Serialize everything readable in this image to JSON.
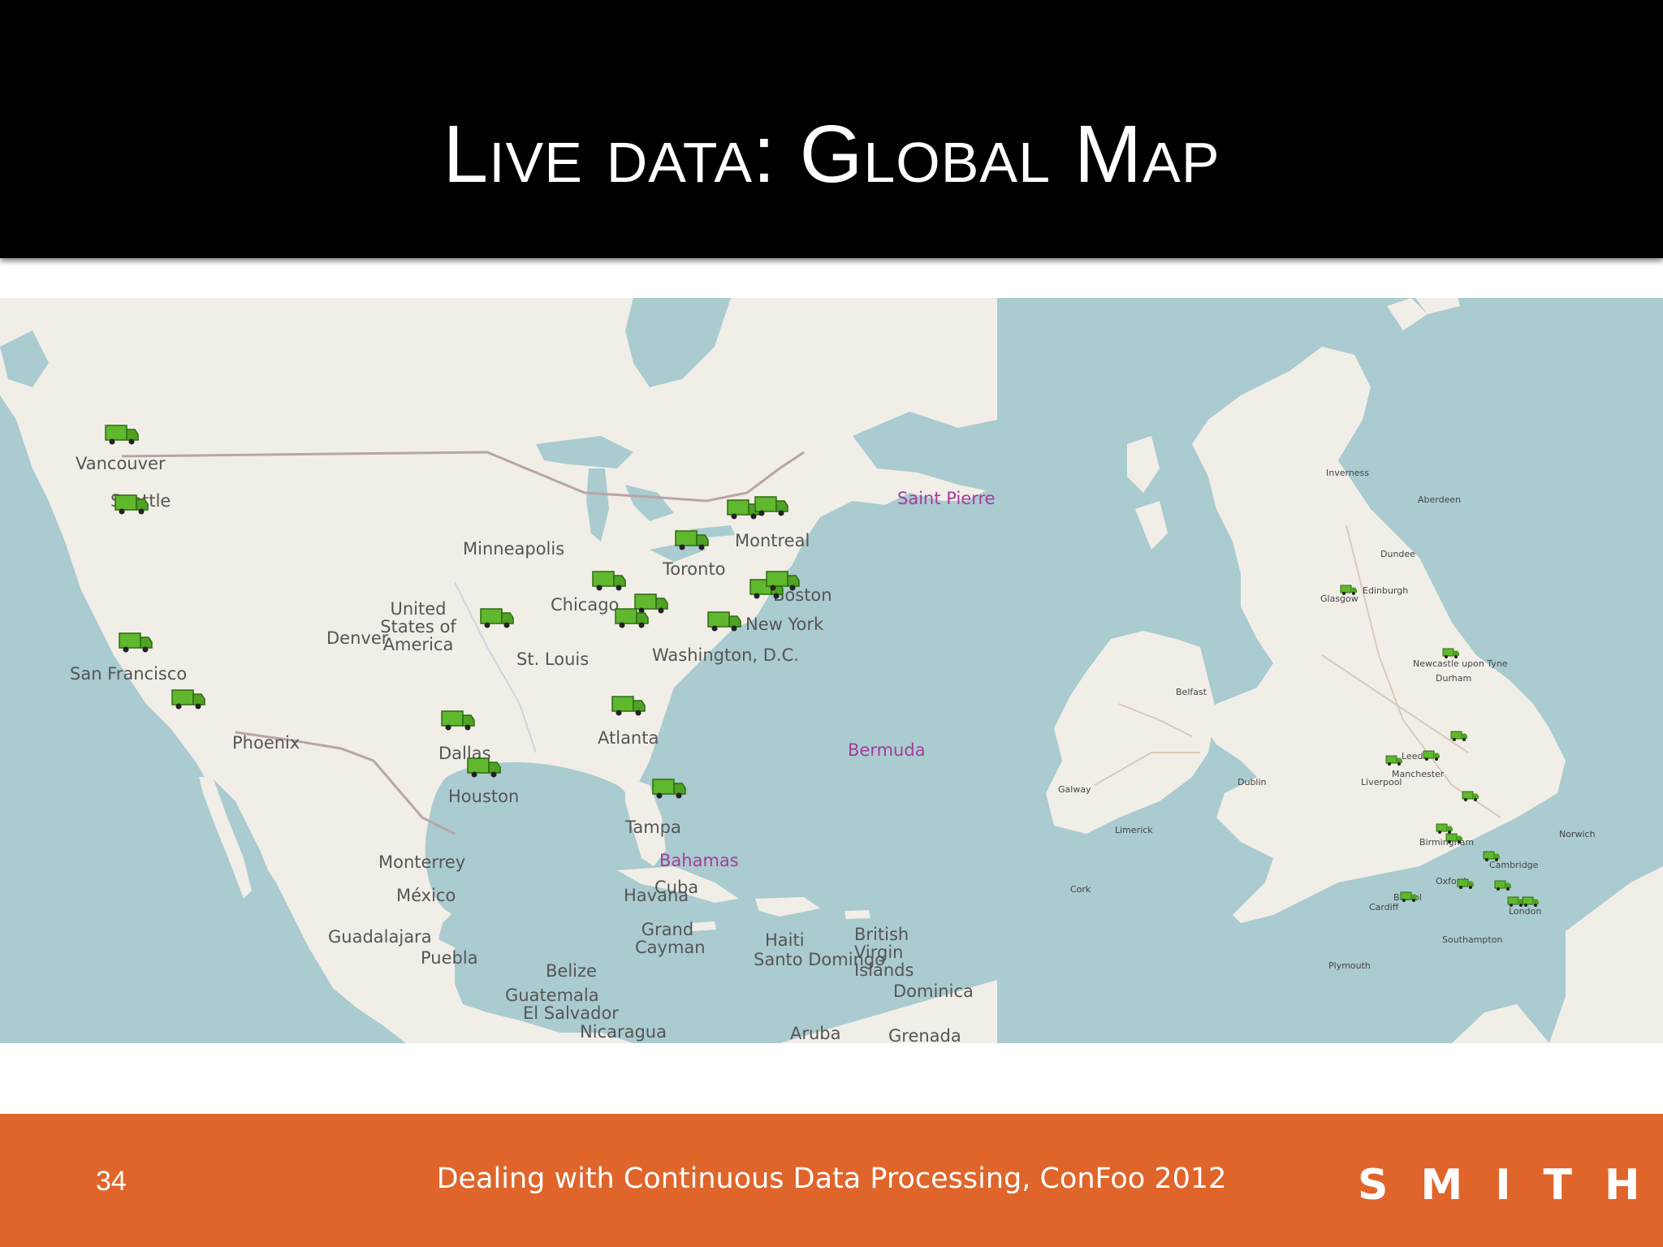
{
  "slide": {
    "title": "Live data: Global Map",
    "number": "34",
    "caption": "Dealing with Continuous Data Processing, ConFoo 2012",
    "brand": "SMITH",
    "trademark": "™"
  },
  "colors": {
    "header_bg": "#000000",
    "footer_bg": "#e0652b",
    "land": "#f1eee8",
    "water": "#aacbd0",
    "marker": "#5fb82d",
    "water_label": "#a43d9b"
  },
  "marker_icon": "truck-icon",
  "maps": {
    "north_america": {
      "places": [
        "Vancouver",
        "Seattle",
        "Minneapolis",
        "Chicago",
        "Toronto",
        "Montreal",
        "Boston",
        "New York",
        "Washington, D.C.",
        "United States of America",
        "Denver",
        "St. Louis",
        "San Francisco",
        "Phoenix",
        "Dallas",
        "Houston",
        "Atlanta",
        "Tampa",
        "Monterrey",
        "México",
        "Guadalajara",
        "Puebla",
        "Belize",
        "Guatemala",
        "El Salvador",
        "Nicaragua",
        "Havana",
        "Cuba",
        "Grand Cayman",
        "Haiti",
        "Santo Domingo",
        "British Virgin Islands",
        "Dominica",
        "Aruba",
        "Grenada"
      ],
      "water_places": [
        "Saint Pierre",
        "Bermuda",
        "Bahamas"
      ]
    },
    "uk": {
      "places": [
        "Inverness",
        "Aberdeen",
        "Dundee",
        "Edinburgh",
        "Glasgow",
        "Newcastle upon Tyne",
        "Durham",
        "Belfast",
        "Dublin",
        "Galway",
        "Limerick",
        "Cork",
        "Leeds",
        "Manchester",
        "Liverpool",
        "Birmingham",
        "Cambridge",
        "Oxford",
        "Cardiff",
        "Bristol",
        "London",
        "Southampton",
        "Plymouth",
        "Norwich"
      ]
    }
  }
}
